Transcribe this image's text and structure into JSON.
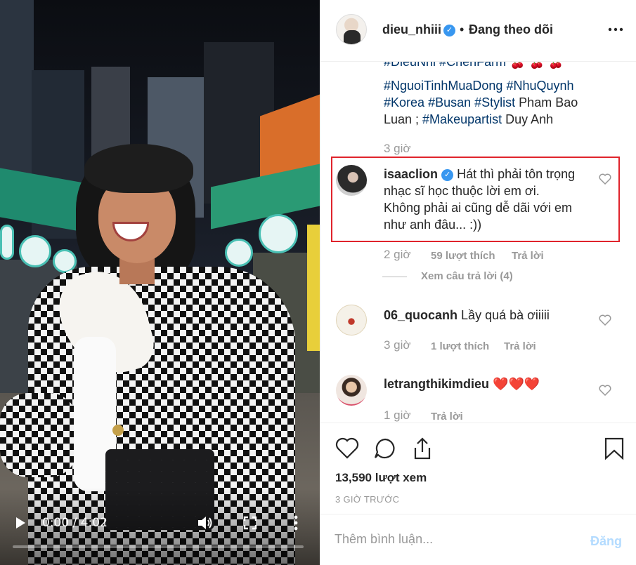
{
  "video": {
    "current_time": "0:00",
    "separator": " / ",
    "duration": "4:02",
    "progress": 0.0,
    "icons": [
      "play-icon",
      "volume-icon",
      "fullscreen-icon",
      "more-vertical-icon"
    ]
  },
  "header": {
    "username": "dieu_nhiii",
    "dot": "•",
    "follow_status": "Đang theo dõi"
  },
  "caption": {
    "lines": [
      [
        "#DieuNhi",
        " ",
        "#CheriFarm",
        " 🍒 🍒 🍒"
      ],
      [
        "#NguoiTinhMuaDong",
        " ",
        "#NhuQuynh"
      ],
      [
        "#Korea",
        " ",
        "#Busan",
        " ",
        "#Stylist",
        " Pham Bao"
      ],
      [
        "Luan ; ",
        "#Makeupartist",
        " Duy Anh"
      ]
    ],
    "time": "3 giờ"
  },
  "comments": [
    {
      "user": "isaaclion",
      "verified": true,
      "text_lines": [
        "Hát thì phải tôn trọng",
        "nhạc sĩ học thuộc lời em ơi.",
        "Không phải ai cũng dễ dãi với em",
        "như anh đâu... :))"
      ],
      "time": "2 giờ",
      "likes": "59 lượt thích",
      "reply": "Trả lời",
      "view_replies": "Xem câu trả lời (4)"
    },
    {
      "user": "06_quocanh",
      "text": "Lầy quá bà ơiiiii",
      "time": "3 giờ",
      "likes": "1 lượt thích",
      "reply": "Trả lời"
    },
    {
      "user": "letrangthikimdieu",
      "text": "❤️❤️❤️",
      "time": "1 giờ",
      "reply": "Trả lời"
    }
  ],
  "actions": {
    "icons": [
      "heart-icon",
      "comment-icon",
      "share-icon",
      "bookmark-icon"
    ],
    "views": "13,590 lượt xem",
    "posted": "3 GIỜ TRƯỚC"
  },
  "add_comment": {
    "placeholder": "Thêm bình luận...",
    "post_label": "Đăng"
  },
  "colors": {
    "verified": "#3897f0",
    "hashtag": "#003569",
    "highlight_border": "#e0242c",
    "post_disabled": "#b3dbff",
    "muted": "#999999"
  }
}
